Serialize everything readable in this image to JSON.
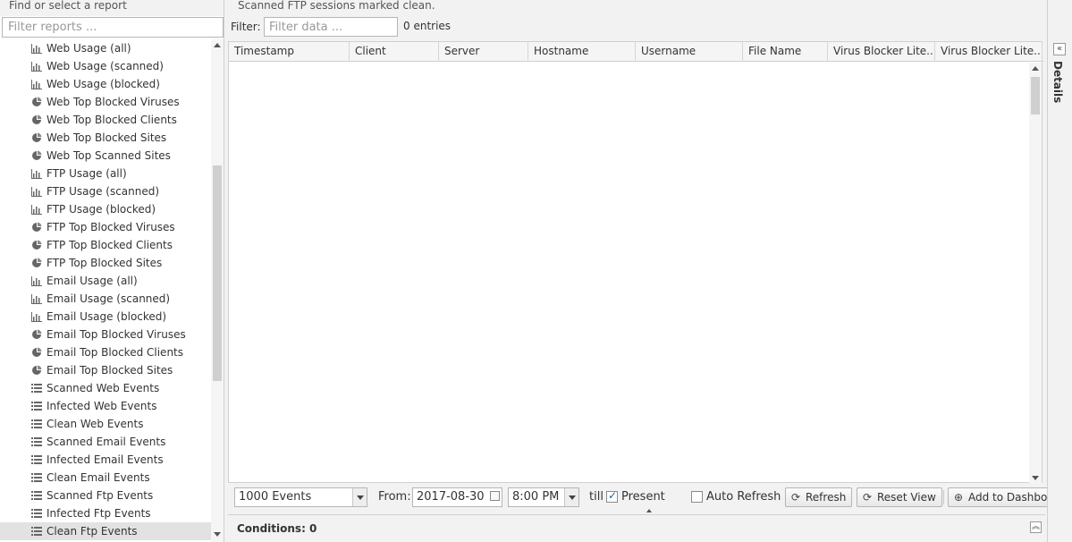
{
  "left_panel": {
    "header": "Find or select a report",
    "filter_placeholder": "Filter reports ...",
    "items": [
      {
        "label": "Web Usage (all)",
        "icon": "bar-chart-icon"
      },
      {
        "label": "Web Usage (scanned)",
        "icon": "bar-chart-icon"
      },
      {
        "label": "Web Usage (blocked)",
        "icon": "bar-chart-icon"
      },
      {
        "label": "Web Top Blocked Viruses",
        "icon": "pie-chart-icon"
      },
      {
        "label": "Web Top Blocked Clients",
        "icon": "pie-chart-icon"
      },
      {
        "label": "Web Top Blocked Sites",
        "icon": "pie-chart-icon"
      },
      {
        "label": "Web Top Scanned Sites",
        "icon": "pie-chart-icon"
      },
      {
        "label": "FTP Usage (all)",
        "icon": "bar-chart-icon"
      },
      {
        "label": "FTP Usage (scanned)",
        "icon": "bar-chart-icon"
      },
      {
        "label": "FTP Usage (blocked)",
        "icon": "bar-chart-icon"
      },
      {
        "label": "FTP Top Blocked Viruses",
        "icon": "pie-chart-icon"
      },
      {
        "label": "FTP Top Blocked Clients",
        "icon": "pie-chart-icon"
      },
      {
        "label": "FTP Top Blocked Sites",
        "icon": "pie-chart-icon"
      },
      {
        "label": "Email Usage (all)",
        "icon": "bar-chart-icon"
      },
      {
        "label": "Email Usage (scanned)",
        "icon": "bar-chart-icon"
      },
      {
        "label": "Email Usage (blocked)",
        "icon": "bar-chart-icon"
      },
      {
        "label": "Email Top Blocked Viruses",
        "icon": "pie-chart-icon"
      },
      {
        "label": "Email Top Blocked Clients",
        "icon": "pie-chart-icon"
      },
      {
        "label": "Email Top Blocked Sites",
        "icon": "pie-chart-icon"
      },
      {
        "label": "Scanned Web Events",
        "icon": "list-icon"
      },
      {
        "label": "Infected Web Events",
        "icon": "list-icon"
      },
      {
        "label": "Clean Web Events",
        "icon": "list-icon"
      },
      {
        "label": "Scanned Email Events",
        "icon": "list-icon"
      },
      {
        "label": "Infected Email Events",
        "icon": "list-icon"
      },
      {
        "label": "Clean Email Events",
        "icon": "list-icon"
      },
      {
        "label": "Scanned Ftp Events",
        "icon": "list-icon"
      },
      {
        "label": "Infected Ftp Events",
        "icon": "list-icon"
      },
      {
        "label": "Clean Ftp Events",
        "icon": "list-icon",
        "selected": true
      }
    ]
  },
  "main": {
    "description": "Scanned FTP sessions marked clean.",
    "filter_label": "Filter:",
    "filter_placeholder": "Filter data ...",
    "entries": "0 entries",
    "columns": [
      "Timestamp",
      "Client",
      "Server",
      "Hostname",
      "Username",
      "File Name",
      "Virus Blocker Lite...",
      "Virus Blocker Lite..."
    ],
    "rows": []
  },
  "bottom_bar": {
    "limit_value": "1000 Events",
    "from_label": "From:",
    "date_value": "2017-08-30",
    "time_value": "8:00 PM",
    "till_label": "till",
    "present_label": "Present",
    "present_checked": true,
    "auto_refresh_label": "Auto Refresh",
    "auto_refresh_checked": false,
    "refresh_label": "Refresh",
    "reset_view_label": "Reset View",
    "add_dashboard_label": "Add to Dashboard"
  },
  "conditions": {
    "label": "Conditions: 0"
  },
  "details": {
    "label": "Details"
  }
}
